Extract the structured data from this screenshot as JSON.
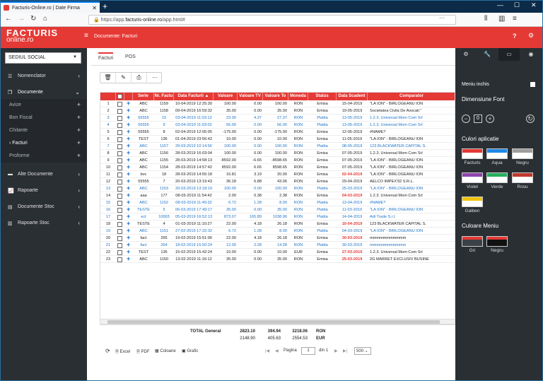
{
  "browser": {
    "tab_title": "Facturis-Online.ro | Date Firma",
    "url_prefix": "https://app.",
    "url_domain": "facturis-online.ro",
    "url_path": "/app.html#"
  },
  "app": {
    "logo_line1": "FACTURIS",
    "logo_line2": "online.ro",
    "breadcrumb": "Documente: Facturi"
  },
  "sidebar": {
    "company": "SEDIUL SOCIAL",
    "items": [
      {
        "label": "Nomenclator",
        "icon": "list-icon"
      },
      {
        "label": "Documente",
        "icon": "documents-icon"
      }
    ],
    "subitems": [
      {
        "label": "Avize"
      },
      {
        "label": "Bon Fiscal"
      },
      {
        "label": "Chitante"
      },
      {
        "label": "› Facturi"
      },
      {
        "label": "Proforme"
      }
    ],
    "lower": [
      {
        "label": "Alte Documente",
        "icon": "folder-icon"
      },
      {
        "label": "Rapoarte",
        "icon": "chart-icon"
      },
      {
        "label": "Documente Stoc",
        "icon": "document-icon"
      },
      {
        "label": "Rapoarte Stoc",
        "icon": "bar-chart-icon"
      }
    ]
  },
  "tabs": [
    "Facturi",
    "POS"
  ],
  "columns": [
    "Serie",
    "Nr. Factu",
    "Data Facturii ▲",
    "Valoare",
    "Valoare TV",
    "Valoare To",
    "Moneda",
    "Status",
    "Data Scadent",
    "Comparator"
  ],
  "rows": [
    [
      "1",
      "ABC",
      "1159",
      "10-04-2019 12:25:30",
      "100.00",
      "0.00",
      "100.00",
      "RON",
      "Emisa",
      "15-04-2019",
      "\"LA ION\" - BIRLOGEANU ION",
      "n"
    ],
    [
      "2",
      "ABC",
      "1158",
      "09-04-2019 16:59:32",
      "35.00",
      "0.00",
      "35.00",
      "RON",
      "Emisa",
      "19-05-2019",
      "Societatea Civila De Avocati \"",
      "n"
    ],
    [
      "3",
      "55555",
      "10",
      "03-04-2019 11:03:12",
      "23.00",
      "4.37",
      "27.37",
      "RON",
      "Platita",
      "13-05-2019",
      "1.2.3. Universal Mom Com Srl",
      "b"
    ],
    [
      "4",
      "55555",
      "9",
      "03-04-2019 11:03:02",
      "56.00",
      "0.00",
      "56.00",
      "RON",
      "Platita",
      "13-05-2019",
      "1.2.3. Universal Mom Com Srl",
      "b"
    ],
    [
      "5",
      "55555",
      "8",
      "02-04-2019 12:05:05",
      "-175.00",
      "0.00",
      "-175.00",
      "RON",
      "Emisa",
      "12-05-2019",
      "#NAME?",
      "n"
    ],
    [
      "6",
      "TEST",
      "136",
      "01-04-2019 23:56:42",
      "10.00",
      "0.00",
      "10.00",
      "RON",
      "Emisa",
      "11-05-2019",
      "\"LA ION\" - BIRLOGEANU ION",
      "n"
    ],
    [
      "7",
      "ABC",
      "1157",
      "29-03-2019 10:14:56",
      "100.00",
      "0.00",
      "100.00",
      "RON",
      "Platita",
      "08-05-2019",
      "123 BLACKWATER CAPITAL S.",
      "b"
    ],
    [
      "8",
      "ABC",
      "1156",
      "28-03-2019 16:03:04",
      "100.00",
      "0.00",
      "100.00",
      "RON",
      "Emisa",
      "07-05-2019",
      "1.2.3. Universal Mom Com Srl",
      "n"
    ],
    [
      "9",
      "ABC",
      "1155",
      "28-03-2019 14:58:13",
      "-8592.00",
      "-6.65",
      "-8598.65",
      "RON",
      "Emisa",
      "07-05-2019",
      "\"LA ION\" - BIRLOGEANU ION",
      "n"
    ],
    [
      "10",
      "ABC",
      "1154",
      "28-03-2019 14:57:42",
      "8592.00",
      "6.65",
      "8598.65",
      "RON",
      "Emisa",
      "07-05-2019",
      "\"LA ION\" - BIRLOGEANU ION",
      "n"
    ],
    [
      "11",
      "bvc",
      "18",
      "28-03-2019 14:55:18",
      "16.81",
      "3.19",
      "20.00",
      "RON",
      "Emisa",
      "02-04-2019",
      "\"LA ION\" - BIRLOGEANU ION",
      "r"
    ],
    [
      "12",
      "55555",
      "7",
      "20-03-2019 13:19:43",
      "36.18",
      "6.88",
      "43.06",
      "RON",
      "Emisa",
      "29-04-2019",
      "AELCO IMPEX'92 S.R.L.",
      "n"
    ],
    [
      "13",
      "ABC",
      "1153",
      "20-03-2019 13:18:19",
      "100.00",
      "0.00",
      "100.00",
      "RON",
      "Platita",
      "25-03-2019",
      "\"LA ION\" - BIRLOGEANU ION",
      "b"
    ],
    [
      "14",
      "aaa",
      "177",
      "08-03-2019 11:54:42",
      "2.00",
      "0.38",
      "2.38",
      "RON",
      "Emisa",
      "04-03-2019",
      "1.2.3. Universal Mom Com Srl",
      "r"
    ],
    [
      "15",
      "ABC",
      "1152",
      "08-03-2019 11:49:32",
      "6.72",
      "1.28",
      "8.00",
      "RON",
      "Platita",
      "13-04-2019",
      "#NAME?",
      "b"
    ],
    [
      "16",
      "TESTE",
      "5",
      "06-03-2019 17:49:17",
      "35.00",
      "0.00",
      "35.00",
      "RON",
      "Platita",
      "11-03-2019",
      "\"LA ION\" - BIRLOGEANU ION",
      "b"
    ],
    [
      "17",
      "ect",
      "10003",
      "05-03-2019 16:52:13",
      "873.07",
      "165.89",
      "1038.96",
      "RON",
      "Platita",
      "14-04-2019",
      "Adi Trade S.r.l.",
      "b"
    ],
    [
      "18",
      "TESTE",
      "4",
      "01-03-2019 11:10:27",
      "22.00",
      "4.18",
      "26.18",
      "RON",
      "Emisa",
      "10-04-2019",
      "123 BLACKWATER CAPITAL S.",
      "r"
    ],
    [
      "19",
      "ABC",
      "1151",
      "27-02-2019 17:32:32",
      "6.72",
      "1.28",
      "8.00",
      "RON",
      "Platita",
      "04-03-2019",
      "\"LA ION\" - BIRLOGEANU ION",
      "b"
    ],
    [
      "20",
      "fact",
      "265",
      "19-02-2019 15:51:06",
      "22.00",
      "4.18",
      "26.18",
      "RON",
      "Emisa",
      "30-03-2019",
      "mmmmmmmmmmm",
      "r"
    ],
    [
      "21",
      "fact",
      "264",
      "18-02-2019 15:50:24",
      "12.00",
      "2.28",
      "14.28",
      "RON",
      "Platita",
      "30-03-2019",
      "mmmmmmmmmmm",
      "b"
    ],
    [
      "22",
      "TEST",
      "135",
      "15-02-2019 15:42:24",
      "10.00",
      "0.00",
      "10.00",
      "EUR",
      "Emisa",
      "27-03-2019",
      "1.2.3. Universal Mom Com Srl",
      "r"
    ],
    [
      "23",
      "ABC",
      "1150",
      "13-02-2019 11:16:12",
      "35.00",
      "0.00",
      "35.00",
      "RON",
      "Emisa",
      "25-03-2019",
      "2G MARKET EXCLUSIV BUSINE",
      "r"
    ]
  ],
  "totals": {
    "label": "TOTAL General",
    "v1": "2823.10",
    "tva1": "394.94",
    "tot1": "3218.06",
    "m1": "RON",
    "v2": "2148.90",
    "tva2": "405.63",
    "tot2": "2554.53",
    "m2": "EUR"
  },
  "export": {
    "excel": "Excel",
    "pdf": "PDF",
    "coloane": "Coloane",
    "grafic": "Grafic"
  },
  "pager": {
    "pagina": "Pagina",
    "page": "1",
    "din": "din 1",
    "per_page": "500"
  },
  "rpanel": {
    "menu_closed": "Meniu inchis",
    "font_title": "Dimensiune Font",
    "font_value": "0",
    "colors_title": "Culori aplicatie",
    "colors": [
      {
        "name": "Facturis",
        "color": "#e53935"
      },
      {
        "name": "Aqua",
        "color": "#1e88e5"
      },
      {
        "name": "Negru",
        "color": "#9e9e9e"
      },
      {
        "name": "Violet",
        "color": "#8e44ad"
      },
      {
        "name": "Verde",
        "color": "#27ae60"
      },
      {
        "name": "Rosu",
        "color": "#c0392b"
      },
      {
        "name": "Galben",
        "color": "#f1c40f"
      }
    ],
    "menu_color_title": "Culoare Meniu",
    "menu_colors": [
      {
        "name": "Gri",
        "color": "#3c4146"
      },
      {
        "name": "Negru",
        "color": "#111111"
      }
    ]
  }
}
